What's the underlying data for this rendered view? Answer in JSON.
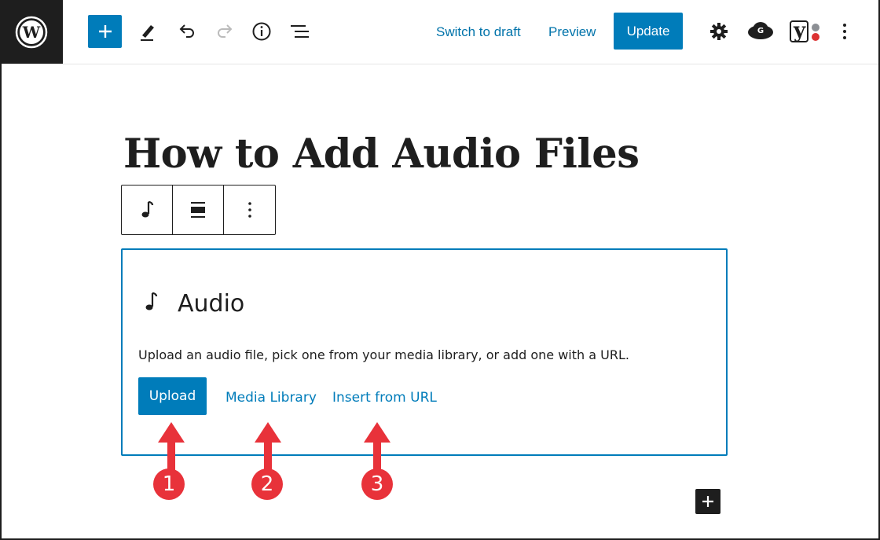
{
  "toolbar": {
    "switch_to_draft": "Switch to draft",
    "preview": "Preview",
    "update": "Update",
    "yoast_letter": "y"
  },
  "post": {
    "title": "How to Add Audio Files"
  },
  "audio_block": {
    "label": "Audio",
    "instructions": "Upload an audio file, pick one from your media library, or add one with a URL.",
    "upload": "Upload",
    "media_library": "Media Library",
    "insert_from_url": "Insert from URL"
  },
  "annotations": {
    "steps": [
      "1",
      "2",
      "3"
    ],
    "color": "#e8323a"
  },
  "colors": {
    "accent": "#007cba",
    "dark": "#1e1e1e"
  },
  "icons": [
    "wordpress-logo-icon",
    "plus-icon",
    "pencil-icon",
    "undo-icon",
    "redo-icon",
    "info-icon",
    "list-view-icon",
    "gear-icon",
    "grammarly-icon",
    "yoast-icon",
    "more-vertical-icon",
    "music-note-icon",
    "align-icon"
  ]
}
